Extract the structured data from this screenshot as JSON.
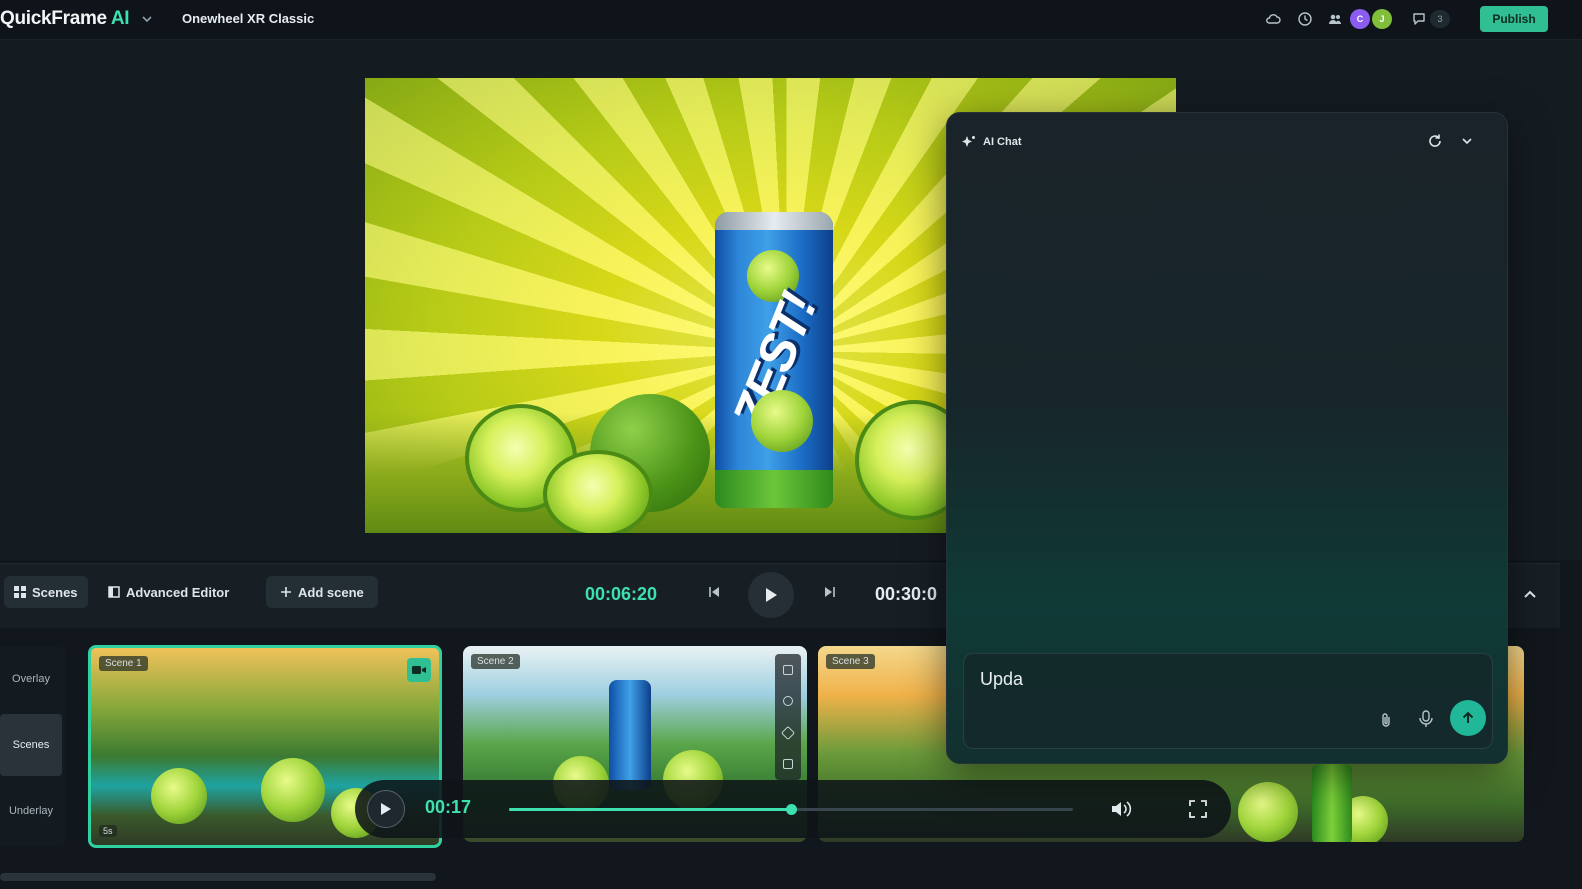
{
  "header": {
    "brand_name": "QuickFrame",
    "brand_suffix": "AI",
    "project_title": "Onewheel XR Classic",
    "avatars": [
      "C",
      "J"
    ],
    "comment_count": "3",
    "publish_label": "Publish",
    "icons": [
      "cloud-icon",
      "history-icon",
      "users-icon",
      "comment-icon"
    ]
  },
  "preview": {
    "product_text": "ZEST!"
  },
  "transport": {
    "tabs": [
      {
        "label": "Scenes",
        "active": true
      },
      {
        "label": "Advanced Editor",
        "active": false
      }
    ],
    "add_scene_label": "Add scene",
    "current_time": "00:06:20",
    "total_time": "00:30:0"
  },
  "timeline": {
    "layers": [
      "Overlay",
      "Scenes",
      "Underlay"
    ],
    "active_layer": "Scenes",
    "scenes": [
      {
        "label": "Scene 1",
        "duration": "5s",
        "selected": true
      },
      {
        "label": "Scene 2"
      },
      {
        "label": "Scene 3"
      }
    ]
  },
  "player": {
    "time": "00:17",
    "progress": 0.5
  },
  "chat": {
    "title": "AI Chat",
    "input_value": "Upda"
  },
  "colors": {
    "accent": "#3ee0b0",
    "publish": "#2fbf93",
    "background": "#11171c"
  }
}
